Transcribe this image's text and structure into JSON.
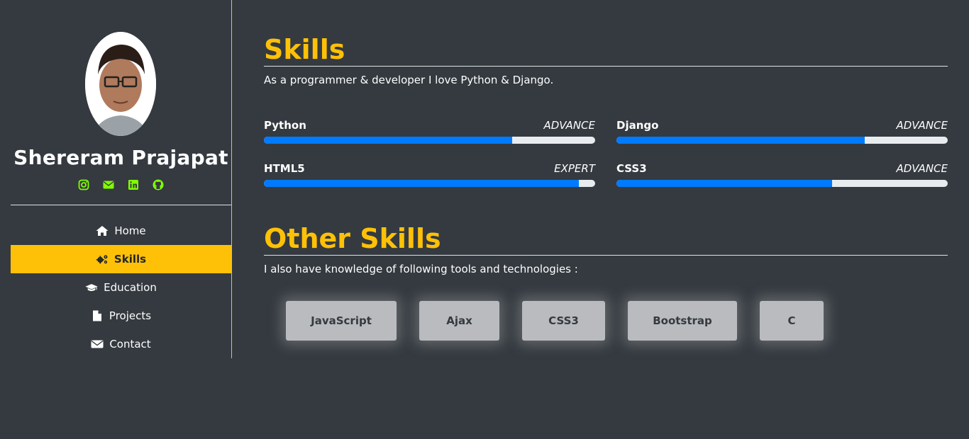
{
  "profile": {
    "name": "Shereram Prajapat",
    "socials": [
      {
        "icon": "instagram-icon",
        "color": "#80ff00"
      },
      {
        "icon": "envelope-icon",
        "color": "#80ff00"
      },
      {
        "icon": "linkedin-icon",
        "color": "#80ff00"
      },
      {
        "icon": "github-icon",
        "color": "#80ff00"
      }
    ]
  },
  "nav": {
    "items": [
      {
        "label": "Home",
        "icon": "home-icon"
      },
      {
        "label": "Skills",
        "icon": "gears-icon",
        "active": true
      },
      {
        "label": "Education",
        "icon": "graduation-cap-icon"
      },
      {
        "label": "Projects",
        "icon": "file-icon"
      },
      {
        "label": "Contact",
        "icon": "envelope-icon"
      }
    ]
  },
  "skills": {
    "title": "Skills",
    "description": "As a programmer & developer I love Python & Django.",
    "items": [
      {
        "name": "Python",
        "level": "ADVANCE",
        "percent": 75
      },
      {
        "name": "Django",
        "level": "ADVANCE",
        "percent": 75
      },
      {
        "name": "HTML5",
        "level": "EXPERT",
        "percent": 95
      },
      {
        "name": "CSS3",
        "level": "ADVANCE",
        "percent": 65
      }
    ]
  },
  "other_skills": {
    "title": "Other Skills",
    "description": "I also have knowledge of following tools and technologies :",
    "tools": [
      "JavaScript",
      "Ajax",
      "CSS3",
      "Bootstrap",
      "C"
    ]
  },
  "colors": {
    "background": "#343a40",
    "accent": "#ffc107",
    "progress": "#007bff",
    "social": "#80ff00"
  }
}
